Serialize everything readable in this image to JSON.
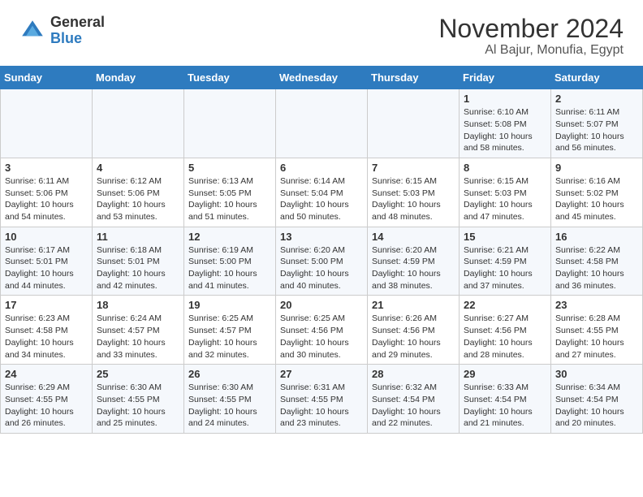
{
  "header": {
    "logo_general": "General",
    "logo_blue": "Blue",
    "month": "November 2024",
    "location": "Al Bajur, Monufia, Egypt"
  },
  "weekdays": [
    "Sunday",
    "Monday",
    "Tuesday",
    "Wednesday",
    "Thursday",
    "Friday",
    "Saturday"
  ],
  "weeks": [
    [
      {
        "day": "",
        "info": ""
      },
      {
        "day": "",
        "info": ""
      },
      {
        "day": "",
        "info": ""
      },
      {
        "day": "",
        "info": ""
      },
      {
        "day": "",
        "info": ""
      },
      {
        "day": "1",
        "info": "Sunrise: 6:10 AM\nSunset: 5:08 PM\nDaylight: 10 hours and 58 minutes."
      },
      {
        "day": "2",
        "info": "Sunrise: 6:11 AM\nSunset: 5:07 PM\nDaylight: 10 hours and 56 minutes."
      }
    ],
    [
      {
        "day": "3",
        "info": "Sunrise: 6:11 AM\nSunset: 5:06 PM\nDaylight: 10 hours and 54 minutes."
      },
      {
        "day": "4",
        "info": "Sunrise: 6:12 AM\nSunset: 5:06 PM\nDaylight: 10 hours and 53 minutes."
      },
      {
        "day": "5",
        "info": "Sunrise: 6:13 AM\nSunset: 5:05 PM\nDaylight: 10 hours and 51 minutes."
      },
      {
        "day": "6",
        "info": "Sunrise: 6:14 AM\nSunset: 5:04 PM\nDaylight: 10 hours and 50 minutes."
      },
      {
        "day": "7",
        "info": "Sunrise: 6:15 AM\nSunset: 5:03 PM\nDaylight: 10 hours and 48 minutes."
      },
      {
        "day": "8",
        "info": "Sunrise: 6:15 AM\nSunset: 5:03 PM\nDaylight: 10 hours and 47 minutes."
      },
      {
        "day": "9",
        "info": "Sunrise: 6:16 AM\nSunset: 5:02 PM\nDaylight: 10 hours and 45 minutes."
      }
    ],
    [
      {
        "day": "10",
        "info": "Sunrise: 6:17 AM\nSunset: 5:01 PM\nDaylight: 10 hours and 44 minutes."
      },
      {
        "day": "11",
        "info": "Sunrise: 6:18 AM\nSunset: 5:01 PM\nDaylight: 10 hours and 42 minutes."
      },
      {
        "day": "12",
        "info": "Sunrise: 6:19 AM\nSunset: 5:00 PM\nDaylight: 10 hours and 41 minutes."
      },
      {
        "day": "13",
        "info": "Sunrise: 6:20 AM\nSunset: 5:00 PM\nDaylight: 10 hours and 40 minutes."
      },
      {
        "day": "14",
        "info": "Sunrise: 6:20 AM\nSunset: 4:59 PM\nDaylight: 10 hours and 38 minutes."
      },
      {
        "day": "15",
        "info": "Sunrise: 6:21 AM\nSunset: 4:59 PM\nDaylight: 10 hours and 37 minutes."
      },
      {
        "day": "16",
        "info": "Sunrise: 6:22 AM\nSunset: 4:58 PM\nDaylight: 10 hours and 36 minutes."
      }
    ],
    [
      {
        "day": "17",
        "info": "Sunrise: 6:23 AM\nSunset: 4:58 PM\nDaylight: 10 hours and 34 minutes."
      },
      {
        "day": "18",
        "info": "Sunrise: 6:24 AM\nSunset: 4:57 PM\nDaylight: 10 hours and 33 minutes."
      },
      {
        "day": "19",
        "info": "Sunrise: 6:25 AM\nSunset: 4:57 PM\nDaylight: 10 hours and 32 minutes."
      },
      {
        "day": "20",
        "info": "Sunrise: 6:25 AM\nSunset: 4:56 PM\nDaylight: 10 hours and 30 minutes."
      },
      {
        "day": "21",
        "info": "Sunrise: 6:26 AM\nSunset: 4:56 PM\nDaylight: 10 hours and 29 minutes."
      },
      {
        "day": "22",
        "info": "Sunrise: 6:27 AM\nSunset: 4:56 PM\nDaylight: 10 hours and 28 minutes."
      },
      {
        "day": "23",
        "info": "Sunrise: 6:28 AM\nSunset: 4:55 PM\nDaylight: 10 hours and 27 minutes."
      }
    ],
    [
      {
        "day": "24",
        "info": "Sunrise: 6:29 AM\nSunset: 4:55 PM\nDaylight: 10 hours and 26 minutes."
      },
      {
        "day": "25",
        "info": "Sunrise: 6:30 AM\nSunset: 4:55 PM\nDaylight: 10 hours and 25 minutes."
      },
      {
        "day": "26",
        "info": "Sunrise: 6:30 AM\nSunset: 4:55 PM\nDaylight: 10 hours and 24 minutes."
      },
      {
        "day": "27",
        "info": "Sunrise: 6:31 AM\nSunset: 4:55 PM\nDaylight: 10 hours and 23 minutes."
      },
      {
        "day": "28",
        "info": "Sunrise: 6:32 AM\nSunset: 4:54 PM\nDaylight: 10 hours and 22 minutes."
      },
      {
        "day": "29",
        "info": "Sunrise: 6:33 AM\nSunset: 4:54 PM\nDaylight: 10 hours and 21 minutes."
      },
      {
        "day": "30",
        "info": "Sunrise: 6:34 AM\nSunset: 4:54 PM\nDaylight: 10 hours and 20 minutes."
      }
    ]
  ]
}
